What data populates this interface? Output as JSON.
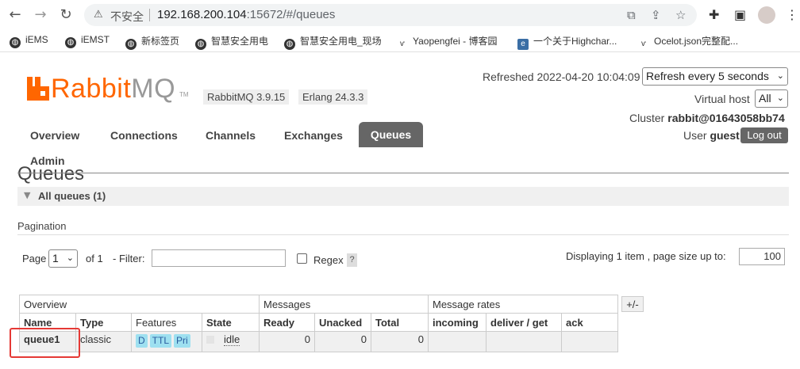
{
  "browser": {
    "insecure_label": "不安全",
    "url_host": "192.168.200.104",
    "url_rest": ":15672/#/queues",
    "bookmarks": [
      "iEMS",
      "iEMST",
      "新标签页",
      "智慧安全用电",
      "智慧安全用电_现场",
      "Yaopengfei - 博客园",
      "一个关于Highchar...",
      "Ocelot.json完整配..."
    ]
  },
  "header": {
    "logo_rabbit": "Rabbit",
    "logo_mq": "MQ",
    "logo_tm": "TM",
    "rabbitmq_version": "RabbitMQ 3.9.15",
    "erlang_version": "Erlang 24.3.3",
    "refreshed": "Refreshed 2022-04-20 10:04:09",
    "refresh_select": "Refresh every 5 seconds",
    "vhost_label": "Virtual host",
    "vhost_select": "All",
    "cluster_label": "Cluster",
    "cluster_name": "rabbit@01643058bb74",
    "user_label": "User",
    "user_name": "guest",
    "logout": "Log out"
  },
  "tabs": [
    "Overview",
    "Connections",
    "Channels",
    "Exchanges",
    "Queues",
    "Admin"
  ],
  "page": {
    "title": "Queues",
    "section": "All queues (1)",
    "pagination_heading": "Pagination",
    "page_label": "Page",
    "page_value": "1",
    "of_label": "of 1",
    "filter_label": "- Filter:",
    "filter_value": "",
    "regex_label": "Regex",
    "help": "?",
    "displaying": "Displaying 1 item , page size up to:",
    "page_size": "100"
  },
  "table": {
    "groups": [
      "Overview",
      "Messages",
      "Message rates"
    ],
    "columns": [
      "Name",
      "Type",
      "Features",
      "State",
      "Ready",
      "Unacked",
      "Total",
      "incoming",
      "deliver / get",
      "ack"
    ],
    "plus_minus": "+/-",
    "rows": [
      {
        "name": "queue1",
        "type": "classic",
        "features": [
          "D",
          "TTL",
          "Pri"
        ],
        "state": "idle",
        "ready": "0",
        "unacked": "0",
        "total": "0",
        "incoming": "",
        "deliver_get": "",
        "ack": ""
      }
    ]
  },
  "colors": {
    "accent": "#ff6600",
    "active_tab": "#666666",
    "highlight_box": "#e53935"
  }
}
